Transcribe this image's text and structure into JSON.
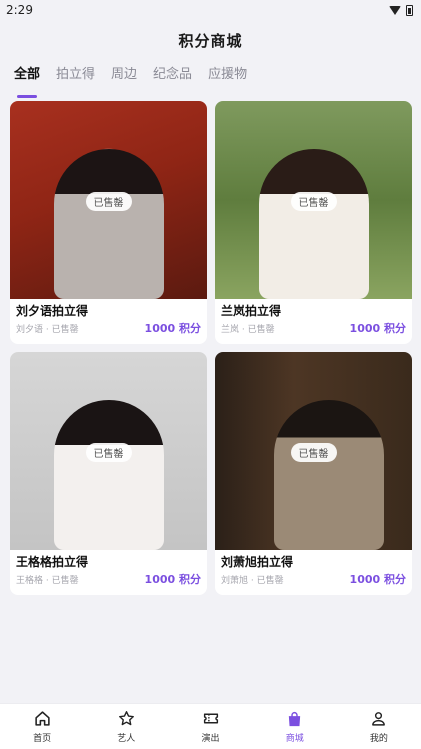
{
  "status_bar": {
    "time": "2:29"
  },
  "header": {
    "title": "积分商城"
  },
  "tabs": [
    {
      "label": "全部",
      "active": true
    },
    {
      "label": "拍立得",
      "active": false
    },
    {
      "label": "周边",
      "active": false
    },
    {
      "label": "纪念品",
      "active": false
    },
    {
      "label": "应援物",
      "active": false
    }
  ],
  "products": [
    {
      "title": "刘夕语拍立得",
      "subtitle": "刘夕语 · 已售罄",
      "badge": "已售罄",
      "price": "1000 积分"
    },
    {
      "title": "兰岚拍立得",
      "subtitle": "兰岚 · 已售罄",
      "badge": "已售罄",
      "price": "1000 积分"
    },
    {
      "title": "王格格拍立得",
      "subtitle": "王格格 · 已售罄",
      "badge": "已售罄",
      "price": "1000 积分"
    },
    {
      "title": "刘萧旭拍立得",
      "subtitle": "刘萧旭 · 已售罄",
      "badge": "已售罄",
      "price": "1000 积分"
    }
  ],
  "bottom_nav": [
    {
      "label": "首页",
      "icon": "home-icon"
    },
    {
      "label": "艺人",
      "icon": "star-icon"
    },
    {
      "label": "演出",
      "icon": "ticket-icon"
    },
    {
      "label": "商城",
      "icon": "shopping-bag-icon",
      "active": true
    },
    {
      "label": "我的",
      "icon": "user-icon"
    }
  ],
  "colors": {
    "accent": "#7b4fe0",
    "background": "#f2f2f6"
  }
}
